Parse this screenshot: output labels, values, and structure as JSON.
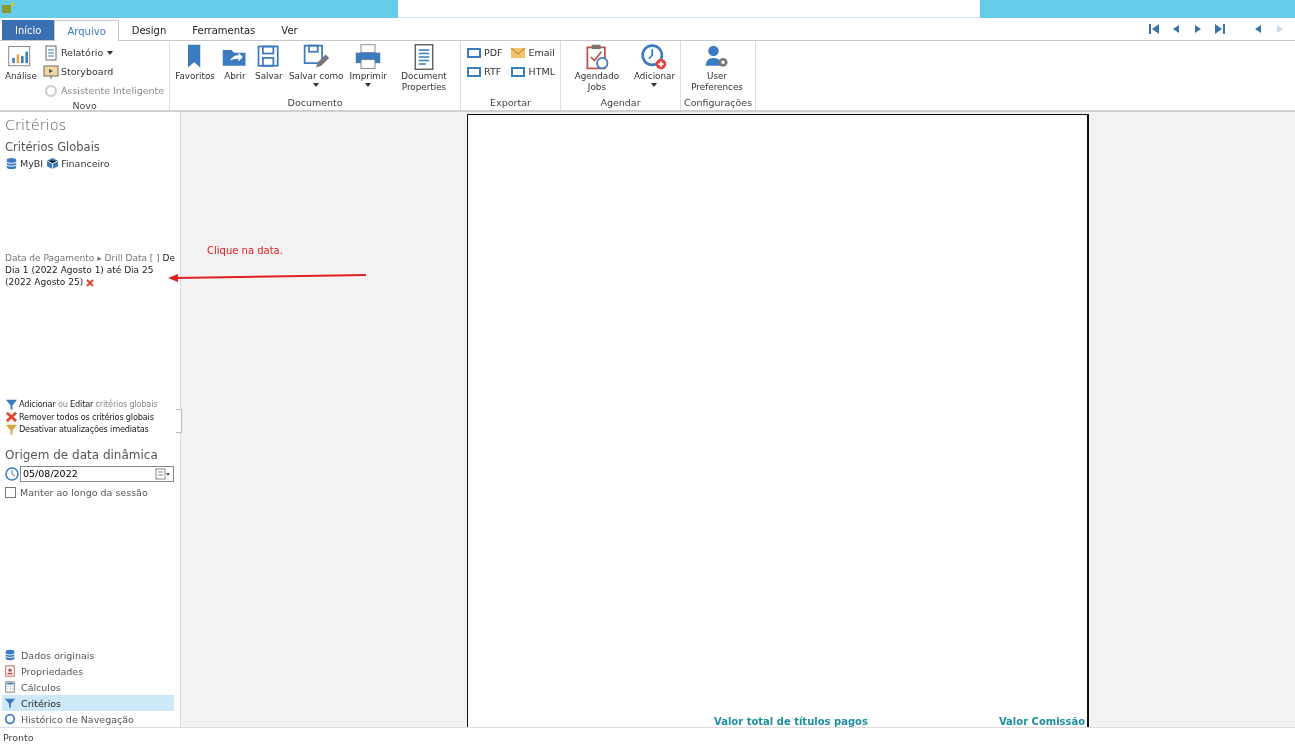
{
  "tabs": [
    {
      "label": "Início",
      "kind": "menu",
      "selected": false
    },
    {
      "label": "Arquivo",
      "kind": "tab",
      "selected": true
    },
    {
      "label": "Design",
      "kind": "tab",
      "selected": false
    },
    {
      "label": "Ferramentas",
      "kind": "tab",
      "selected": false
    },
    {
      "label": "Ver",
      "kind": "tab",
      "selected": false
    }
  ],
  "nav_buttons": [
    {
      "disabled": false
    },
    {
      "disabled": false
    },
    {
      "disabled": false
    },
    {
      "disabled": false
    },
    {
      "disabled": false
    },
    {
      "disabled": true
    }
  ],
  "ribbon": {
    "groups": [
      {
        "label": "Novo",
        "items": [
          {
            "kind": "large",
            "label": "Análise",
            "dropdown": false,
            "disabled": false
          },
          {
            "kind": "small",
            "label": "Relatório",
            "dropdown": true,
            "disabled": false
          },
          {
            "kind": "small",
            "label": "Storyboard",
            "dropdown": false,
            "disabled": false
          },
          {
            "kind": "small",
            "label": "Assistente Inteligente",
            "dropdown": false,
            "disabled": true
          }
        ]
      },
      {
        "label": "Documento",
        "items": [
          {
            "kind": "large",
            "label": "Favoritos",
            "dropdown": false,
            "disabled": false
          },
          {
            "kind": "large",
            "label": "Abrir",
            "dropdown": false,
            "disabled": false
          },
          {
            "kind": "large",
            "label": "Salvar",
            "dropdown": false,
            "disabled": false
          },
          {
            "kind": "large",
            "label": "Salvar como",
            "dropdown": true,
            "disabled": false
          },
          {
            "kind": "large",
            "label": "Imprimir",
            "dropdown": true,
            "disabled": false
          },
          {
            "kind": "large",
            "label": "Document Properties",
            "dropdown": false,
            "disabled": false
          }
        ]
      },
      {
        "label": "Exportar",
        "items": [
          {
            "kind": "small",
            "label": "PDF",
            "dropdown": false,
            "disabled": false
          },
          {
            "kind": "small",
            "label": "Email",
            "dropdown": false,
            "disabled": false
          },
          {
            "kind": "small",
            "label": "RTF",
            "dropdown": false,
            "disabled": false
          },
          {
            "kind": "small",
            "label": "HTML",
            "dropdown": false,
            "disabled": false
          }
        ]
      },
      {
        "label": "Agendar",
        "items": [
          {
            "kind": "large",
            "label": "Agendado Jobs",
            "dropdown": false,
            "disabled": false
          },
          {
            "kind": "large",
            "label": "Adicionar",
            "dropdown": true,
            "disabled": false
          }
        ]
      },
      {
        "label": "Configurações",
        "items": [
          {
            "kind": "large",
            "label": "User Preferences",
            "dropdown": false,
            "disabled": false
          }
        ]
      }
    ]
  },
  "criteria_panel": {
    "title": "Critérios",
    "global_title": "Critérios Globais",
    "sources": [
      "MyBI",
      "Financeiro"
    ],
    "criterion": "Data de Pagamento ▸ Drill Data [ ] **De Dia 1 (2022 Agosto 1) até Dia 25 (2022 Agosto 25)**",
    "actions": [
      "**Adicionar** ou **Editar** critérios globais",
      "**Remover todos os critérios globais**",
      "**Desativar atualizações imediatas**"
    ],
    "date_origin": {
      "title": "Origem de data dinâmica",
      "value": "05/08/2022",
      "keep_label": "Manter ao longo da sessão",
      "checked": false
    }
  },
  "annotation": "Clique na data.",
  "bottom_nav": [
    {
      "label": "Dados originais",
      "selected": false
    },
    {
      "label": "Propriedades",
      "selected": false
    },
    {
      "label": "Cálculos",
      "selected": false
    },
    {
      "label": "Critérios",
      "selected": true
    },
    {
      "label": "Histórico de Navegação",
      "selected": false
    }
  ],
  "report_page": {
    "headers": [
      "Valor total de títulos pagos",
      "Valor Comissão"
    ]
  },
  "status_bar": "Pronto"
}
